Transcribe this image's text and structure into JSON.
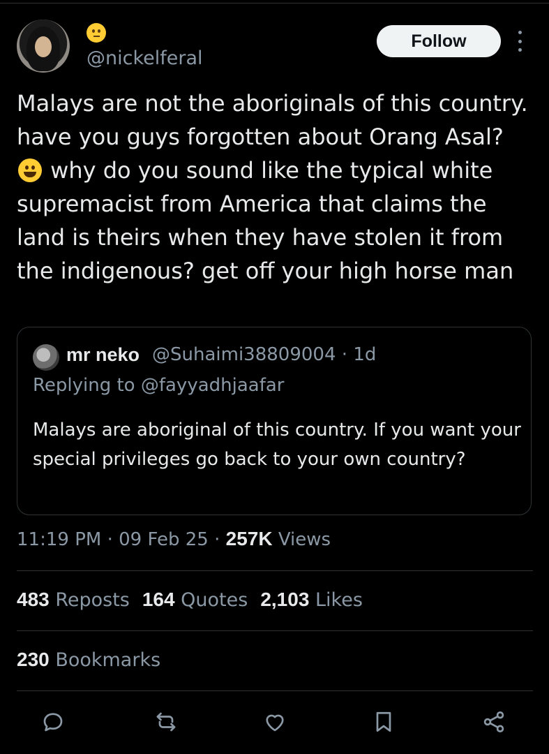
{
  "tweet": {
    "author": {
      "display_name_emoji": "🤨",
      "handle": "@nickelferal"
    },
    "follow_label": "Follow",
    "text_part1": "Malays are not the aboriginals of this country. have you guys forgotten about Orang Asal? ",
    "text_emoji": "😀",
    "text_part2": " why do you sound like the typical white supremacist from America that claims the land is theirs when they have stolen it from the indigenous? get off your high horse man",
    "quoted": {
      "name": "mr neko",
      "handle": "@Suhaimi38809004",
      "separator": "·",
      "age": "1d",
      "replying_to": "Replying to @fayyadhjaafar",
      "text": "Malays are aboriginal of this country. If you want your special privileges go back to your own country?"
    },
    "time": "11:19 PM",
    "date": "09 Feb 25",
    "views_count": "257K",
    "views_label": "Views",
    "reposts_count": "483",
    "reposts_label": "Reposts",
    "quotes_count": "164",
    "quotes_label": "Quotes",
    "likes_count": "2,103",
    "likes_label": "Likes",
    "bookmarks_count": "230",
    "bookmarks_label": "Bookmarks"
  },
  "actions": {
    "icons": [
      "reply-icon",
      "repost-icon",
      "like-icon",
      "bookmark-icon",
      "share-icon"
    ]
  },
  "colors": {
    "background": "#000000",
    "text_primary": "#e7e9ea",
    "text_secondary": "#8b98a5",
    "border": "#2f3336",
    "follow_bg": "#eff3f4"
  }
}
